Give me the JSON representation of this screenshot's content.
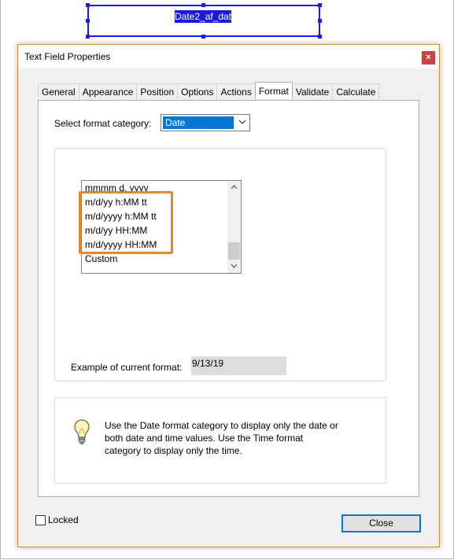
{
  "background": {
    "field_name": "Date2_af_date"
  },
  "dialog": {
    "title": "Text Field Properties",
    "close_icon": "×",
    "tabs": [
      {
        "label": "General"
      },
      {
        "label": "Appearance"
      },
      {
        "label": "Position"
      },
      {
        "label": "Options"
      },
      {
        "label": "Actions"
      },
      {
        "label": "Format",
        "active": true
      },
      {
        "label": "Validate"
      },
      {
        "label": "Calculate"
      }
    ],
    "format": {
      "category_label": "Select format category:",
      "category_value": "Date",
      "list_items": [
        "mmmm d, yyyy",
        "m/d/yy h:MM tt",
        "m/d/yyyy h:MM tt",
        "m/d/yy HH:MM",
        "m/d/yyyy HH:MM",
        "Custom"
      ],
      "example_label": "Example of current format:",
      "example_value": "9/13/19",
      "info_text": "Use the Date format category to display only the date or both date and time values. Use the Time format category to display only the time."
    },
    "locked_label": "Locked",
    "close_button": "Close"
  },
  "colors": {
    "highlight": "#e08a2e",
    "selection": "#0078d7",
    "field_border": "#1a1af0"
  },
  "icons": {
    "scroll_up": "chevron-up-icon",
    "scroll_down": "chevron-down-icon",
    "dropdown": "chevron-down-icon",
    "info": "lightbulb-icon",
    "close": "close-icon"
  }
}
